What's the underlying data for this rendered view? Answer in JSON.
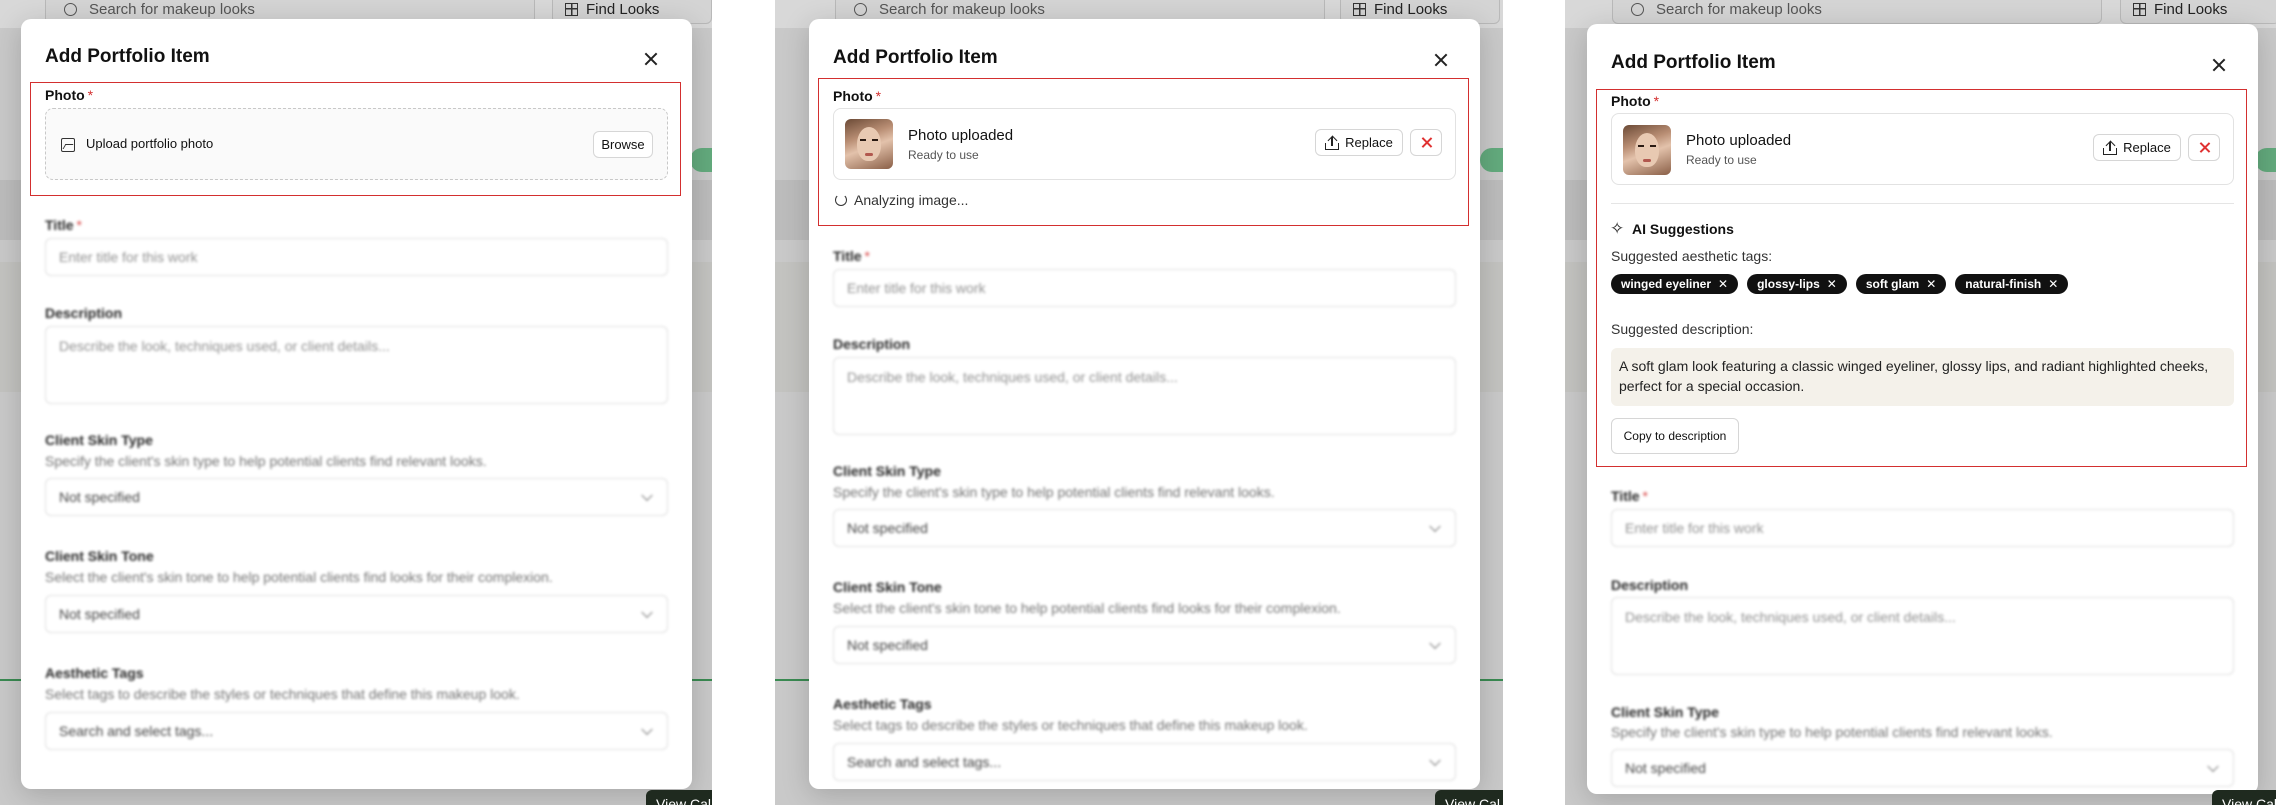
{
  "background": {
    "search_placeholder": "Search for makeup looks",
    "find_looks_label": "Find Looks",
    "view_cal_label": "View Cal"
  },
  "modal": {
    "title": "Add Portfolio Item",
    "photo_label": "Photo",
    "required_mark": "*",
    "upload_placeholder": "Upload portfolio photo",
    "browse_label": "Browse",
    "photo_uploaded": "Photo uploaded",
    "ready_to_use": "Ready to use",
    "replace_label": "Replace",
    "analyzing_label": "Analyzing image...",
    "title_label": "Title",
    "title_placeholder": "Enter title for this work",
    "description_label": "Description",
    "description_placeholder": "Describe the look, techniques used, or client details...",
    "skin_type_label": "Client Skin Type",
    "skin_type_hint": "Specify the client's skin type to help potential clients find relevant looks.",
    "skin_type_value": "Not specified",
    "skin_tone_label": "Client Skin Tone",
    "skin_tone_hint": "Select the client's skin tone to help potential clients find looks for their complexion.",
    "skin_tone_value": "Not specified",
    "aesthetic_tags_label": "Aesthetic Tags",
    "aesthetic_tags_hint": "Select tags to describe the styles or techniques that define this makeup look.",
    "aesthetic_tags_placeholder": "Search and select tags..."
  },
  "ai": {
    "title": "AI Suggestions",
    "tags_label": "Suggested aesthetic tags:",
    "tags": [
      "winged eyeliner",
      "glossy-lips",
      "soft glam",
      "natural-finish"
    ],
    "desc_label": "Suggested description:",
    "description": "A soft glam look featuring a classic winged eyeliner, glossy lips, and radiant highlighted cheeks, perfect for a special occasion.",
    "copy_label": "Copy to description"
  },
  "colors": {
    "highlight": "#d32f2f",
    "tag_bg": "#111111",
    "suggestion_bg": "#f4f1ea",
    "accent_green": "#2e8b57"
  }
}
